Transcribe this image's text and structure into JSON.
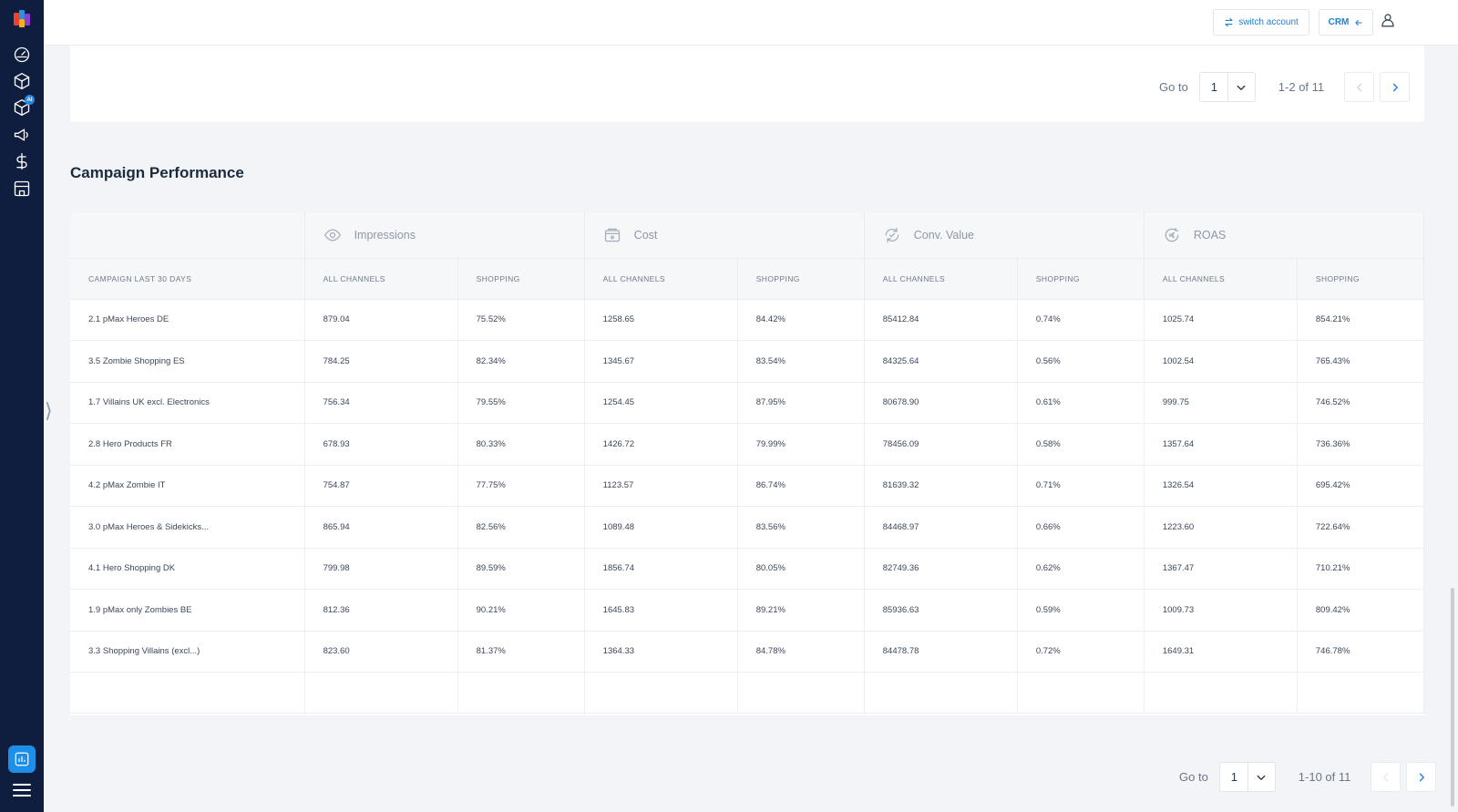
{
  "topbar": {
    "switch_label": "switch account",
    "crm_label": "CRM"
  },
  "top_pager": {
    "goto_label": "Go to",
    "page_value": "1",
    "range": "1-2 of 11"
  },
  "section": {
    "title": "Campaign Performance"
  },
  "table": {
    "groups": [
      {
        "label": "Impressions",
        "icon": "eye-icon"
      },
      {
        "label": "Cost",
        "icon": "wallet-icon"
      },
      {
        "label": "Conv. Value",
        "icon": "refresh-check-icon"
      },
      {
        "label": "ROAS",
        "icon": "euro-cycle-icon"
      }
    ],
    "subheaders": {
      "campaign": "CAMPAIGN LAST 30 DAYS",
      "all": "ALL CHANNELS",
      "shopping": "SHOPPING"
    },
    "rows": [
      {
        "name": "2.1 pMax Heroes DE",
        "imp_all": "879.04",
        "imp_shop": "75.52%",
        "cost_all": "1258.65",
        "cost_shop": "84.42%",
        "conv_all": "85412.84",
        "conv_shop": "0.74%",
        "roas_all": "1025.74",
        "roas_shop": "854.21%"
      },
      {
        "name": "3.5 Zombie Shopping ES",
        "imp_all": "784.25",
        "imp_shop": "82.34%",
        "cost_all": "1345.67",
        "cost_shop": "83.54%",
        "conv_all": "84325.64",
        "conv_shop": "0.56%",
        "roas_all": "1002.54",
        "roas_shop": "765.43%"
      },
      {
        "name": "1.7 Villains UK excl. Electronics",
        "imp_all": "756.34",
        "imp_shop": "79.55%",
        "cost_all": "1254.45",
        "cost_shop": "87.95%",
        "conv_all": "80678.90",
        "conv_shop": "0.61%",
        "roas_all": "999.75",
        "roas_shop": "746.52%"
      },
      {
        "name": "2.8 Hero Products FR",
        "imp_all": "678.93",
        "imp_shop": "80.33%",
        "cost_all": "1426.72",
        "cost_shop": "79.99%",
        "conv_all": "78456.09",
        "conv_shop": "0.58%",
        "roas_all": "1357.64",
        "roas_shop": "736.36%"
      },
      {
        "name": "4.2 pMax Zombie IT",
        "imp_all": "754.87",
        "imp_shop": "77.75%",
        "cost_all": "1123.57",
        "cost_shop": "86.74%",
        "conv_all": "81639.32",
        "conv_shop": "0.71%",
        "roas_all": "1326.54",
        "roas_shop": "695.42%"
      },
      {
        "name": "3.0 pMax Heroes & Sidekicks...",
        "imp_all": "865.94",
        "imp_shop": "82.56%",
        "cost_all": "1089.48",
        "cost_shop": "83.56%",
        "conv_all": "84468.97",
        "conv_shop": "0.66%",
        "roas_all": "1223.60",
        "roas_shop": "722.64%"
      },
      {
        "name": "4.1 Hero Shopping DK",
        "imp_all": "799.98",
        "imp_shop": "89.59%",
        "cost_all": "1856.74",
        "cost_shop": "80.05%",
        "conv_all": "82749.36",
        "conv_shop": "0.62%",
        "roas_all": "1367.47",
        "roas_shop": "710.21%"
      },
      {
        "name": "1.9 pMax only Zombies BE",
        "imp_all": "812.36",
        "imp_shop": "90.21%",
        "cost_all": "1645.83",
        "cost_shop": "89.21%",
        "conv_all": "85936.63",
        "conv_shop": "0.59%",
        "roas_all": "1009.73",
        "roas_shop": "809.42%"
      },
      {
        "name": "3.3 Shopping Villains (excl...)",
        "imp_all": "823.60",
        "imp_shop": "81.37%",
        "cost_all": "1364.33",
        "cost_shop": "84.78%",
        "conv_all": "84478.78",
        "conv_shop": "0.72%",
        "roas_all": "1649.31",
        "roas_shop": "746.78%"
      }
    ]
  },
  "bottom_pager": {
    "goto_label": "Go to",
    "page_value": "1",
    "range": "1-10 of 11"
  },
  "colors": {
    "sidebar": "#0f1d3f",
    "accent": "#1e8fe8",
    "background": "#f2f4f7"
  }
}
